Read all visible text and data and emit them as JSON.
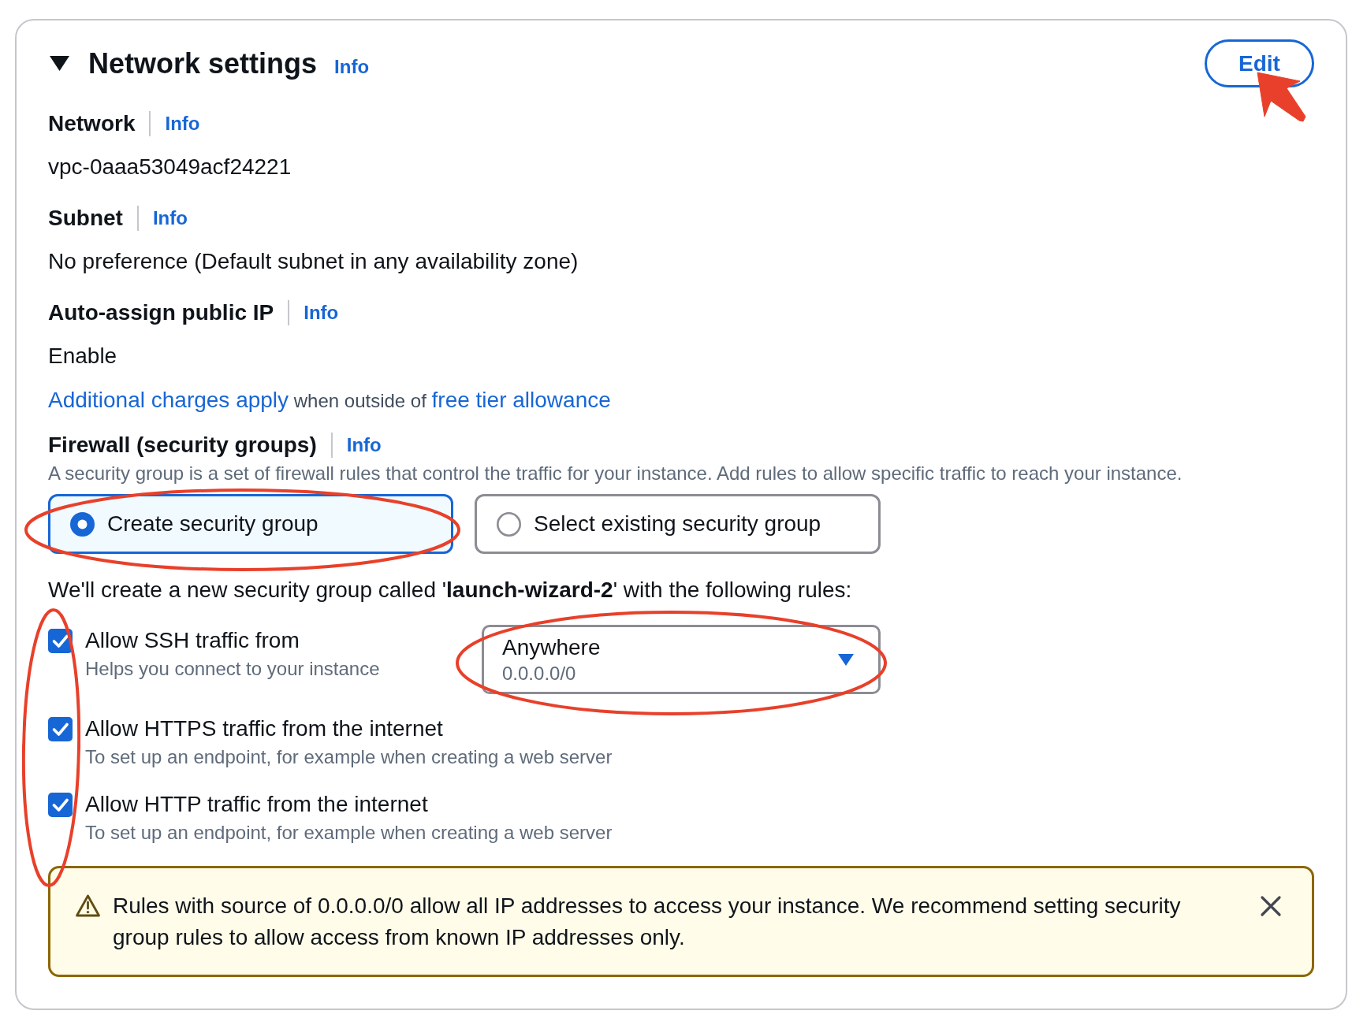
{
  "section": {
    "title": "Network settings",
    "info_link": "Info",
    "expanded": true,
    "edit_button": {
      "label": "Edit",
      "pointed_at": true
    }
  },
  "fields": [
    {
      "label": "Network",
      "info_link": "Info",
      "value": "vpc-0aaa53049acf24221"
    },
    {
      "label": "Subnet",
      "info_link": "Info",
      "value": "No preference (Default subnet in any availability zone)"
    },
    {
      "label": "Auto-assign public IP",
      "info_link": "Info",
      "value": "Enable"
    }
  ],
  "charges_note": [
    {
      "kind": "link",
      "text": "Additional charges apply"
    },
    {
      "kind": "text",
      "text": "when outside of"
    },
    {
      "kind": "link",
      "text": "free tier allowance"
    }
  ],
  "firewall": {
    "label": "Firewall (security groups)",
    "info_link": "Info",
    "description": "A security group is a set of firewall rules that control the traffic for your instance. Add rules to allow specific traffic to reach your instance.",
    "options": [
      {
        "label": "Create security group",
        "selected": true,
        "circled": true
      },
      {
        "label": "Select existing security group",
        "selected": false,
        "circled": false
      }
    ],
    "summary": "We'll create a new security group called '**launch-wizard-2**' with the following rules:",
    "checkboxes_circled": true,
    "rules": [
      {
        "label": "Allow SSH traffic from",
        "description": "Helps you connect to your instance",
        "checked": true,
        "source": {
          "value": "Anywhere",
          "detail": "0.0.0.0/0",
          "circled": true
        }
      },
      {
        "label": "Allow HTTPS traffic from the internet",
        "description": "To set up an endpoint, for example when creating a web server",
        "checked": true
      },
      {
        "label": "Allow HTTP traffic from the internet",
        "description": "To set up an endpoint, for example when creating a web server",
        "checked": true
      }
    ]
  },
  "alert": {
    "kind": "warning",
    "text": "Rules with source of 0.0.0.0/0 allow all IP addresses to access your instance. We recommend setting security group rules to allow access from known IP addresses only.",
    "dismissible": true
  }
}
